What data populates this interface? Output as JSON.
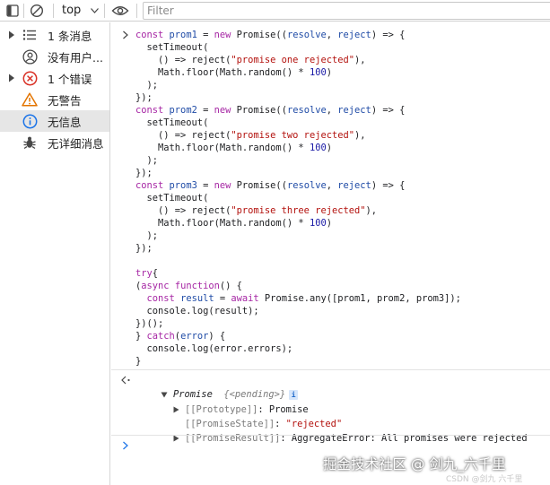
{
  "toolbar": {
    "context": "top",
    "filter_placeholder": "Filter",
    "icons": [
      "sidebar-toggle-icon",
      "clear-console-icon",
      "dropdown-caret-icon",
      "eye-icon"
    ]
  },
  "sidebar": {
    "items": [
      {
        "label": "1 条消息",
        "icon": "list-icon",
        "expandable": true
      },
      {
        "label": "没有用户...",
        "icon": "user-icon",
        "expandable": false
      },
      {
        "label": "1 个错误",
        "icon": "error-icon",
        "expandable": true
      },
      {
        "label": "无警告",
        "icon": "warning-icon",
        "expandable": false
      },
      {
        "label": "无信息",
        "icon": "info-icon",
        "expandable": false,
        "selected": true
      },
      {
        "label": "无详细消息",
        "icon": "bug-icon",
        "expandable": false
      }
    ]
  },
  "code": {
    "l1_a": "const ",
    "l1_b": "prom1",
    "l1_c": " = ",
    "l1_d": "new",
    "l1_e": " Promise((",
    "l1_f": "resolve",
    "l1_g": ", ",
    "l1_h": "reject",
    "l1_i": ") => {",
    "l2": "  setTimeout(",
    "l3_a": "    () => reject(",
    "l3_b": "\"promise one rejected\"",
    "l3_c": "),",
    "l4_a": "    Math.floor(Math.random() * ",
    "l4_b": "100",
    "l4_c": ")",
    "l5": "  );",
    "l6": "});",
    "l7_a": "const ",
    "l7_b": "prom2",
    "l7_c": " = ",
    "l7_d": "new",
    "l7_e": " Promise((",
    "l7_f": "resolve",
    "l7_g": ", ",
    "l7_h": "reject",
    "l7_i": ") => {",
    "l8": "  setTimeout(",
    "l9_a": "    () => reject(",
    "l9_b": "\"promise two rejected\"",
    "l9_c": "),",
    "l10_a": "    Math.floor(Math.random() * ",
    "l10_b": "100",
    "l10_c": ")",
    "l11": "  );",
    "l12": "});",
    "l13_a": "const ",
    "l13_b": "prom3",
    "l13_c": " = ",
    "l13_d": "new",
    "l13_e": " Promise((",
    "l13_f": "resolve",
    "l13_g": ", ",
    "l13_h": "reject",
    "l13_i": ") => {",
    "l14": "  setTimeout(",
    "l15_a": "    () => reject(",
    "l15_b": "\"promise three rejected\"",
    "l15_c": "),",
    "l16_a": "    Math.floor(Math.random() * ",
    "l16_b": "100",
    "l16_c": ")",
    "l17": "  );",
    "l18": "});",
    "l19_a": "try",
    "l19_b": "{",
    "l20_a": "(",
    "l20_b": "async",
    "l20_c": " ",
    "l20_d": "function",
    "l20_e": "() {",
    "l21_a": "  ",
    "l21_b": "const",
    "l21_c": " ",
    "l21_d": "result",
    "l21_e": " = ",
    "l21_f": "await",
    "l21_g": " Promise.any([prom1, prom2, prom3]);",
    "l22": "  console.log(result);",
    "l23": "})();",
    "l24_a": "} ",
    "l24_b": "catch",
    "l24_c": "(",
    "l24_d": "error",
    "l24_e": ") {",
    "l25": "  console.log(error.errors);",
    "l26": "}"
  },
  "result": {
    "header_type": "Promise",
    "header_state": "{<pending>}",
    "badge": "i",
    "prototype_key": "[[Prototype]]",
    "prototype_value": "Promise",
    "state_key": "[[PromiseState]]",
    "state_value": "\"rejected\"",
    "result_key": "[[PromiseResult]]",
    "result_value": "AggregateError: All promises were rejected"
  },
  "watermark": {
    "main": "掘金技术社区 @ 剑九_六千里",
    "sub": "CSDN @剑九 六千里"
  },
  "colors": {
    "keyword": "#a626a4",
    "string": "#b3110d",
    "number": "#1a1aa6",
    "variable": "#1f4ba6",
    "selected_bg": "#e6e6e6"
  }
}
